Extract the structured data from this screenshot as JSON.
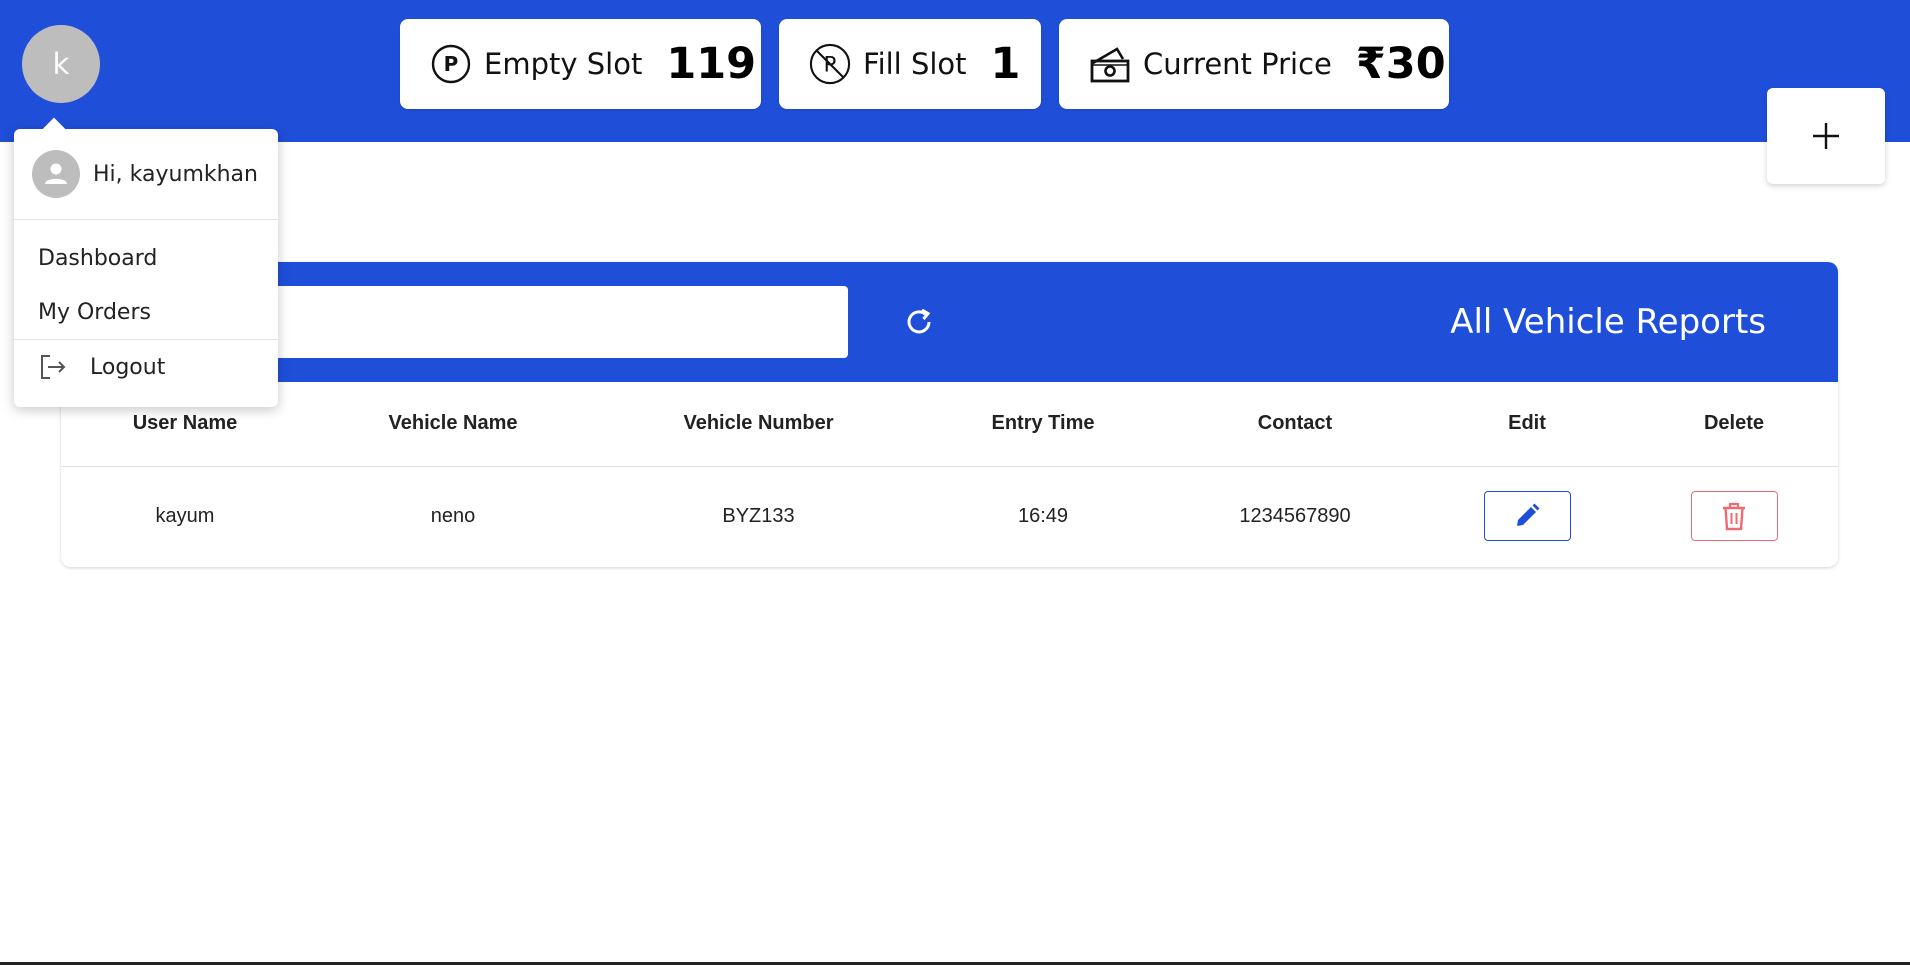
{
  "header": {
    "avatar_letter": "k",
    "stats": [
      {
        "label": "Empty Slot",
        "value": "119",
        "icon": "parking-icon"
      },
      {
        "label": "Fill Slot",
        "value": "1",
        "icon": "no-parking-icon"
      },
      {
        "label": "Current Price",
        "value": "₹30",
        "icon": "money-icon"
      }
    ],
    "add_icon": "plus-icon"
  },
  "user_menu": {
    "greeting": "Hi, kayumkhan",
    "items": [
      "Dashboard",
      "My Orders"
    ],
    "logout_label": "Logout"
  },
  "reports": {
    "search_placeholder": "Search",
    "title": "All Vehicle Reports",
    "columns": [
      "User Name",
      "Vehicle Name",
      "Vehicle Number",
      "Entry Time",
      "Contact",
      "Edit",
      "Delete"
    ],
    "rows": [
      {
        "user_name": "kayum",
        "vehicle_name": "neno",
        "vehicle_number": "BYZ133",
        "entry_time": "16:49",
        "contact": "1234567890"
      }
    ]
  },
  "colors": {
    "primary": "#1f4fd9",
    "delete": "#ef6b73",
    "avatar": "#bdbdbd"
  }
}
